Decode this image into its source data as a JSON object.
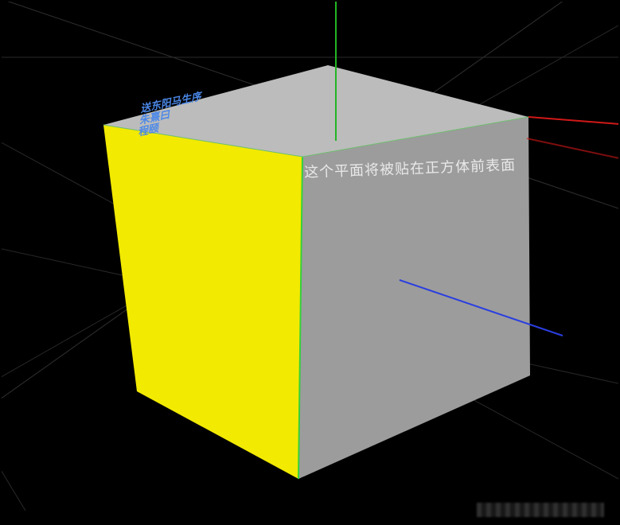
{
  "scene": {
    "cube": {
      "front_face_label": "这个平面将被贴在正方体前表面",
      "left_face_color": "#f2ea00",
      "front_face_color": "#9c9c9c",
      "top_face_color": "#bcbcbc",
      "edge_highlight_color": "#35d03a"
    },
    "top_info_text": "送东阳马生序  \n朱熹曰  \n程颐",
    "axes": {
      "x_color": "#d11818",
      "y_color": "#23b623",
      "z_color": "#2a3ee0"
    },
    "grid_color_1": "#3a3a3a",
    "grid_color_2": "#262626",
    "background": "#000000"
  }
}
